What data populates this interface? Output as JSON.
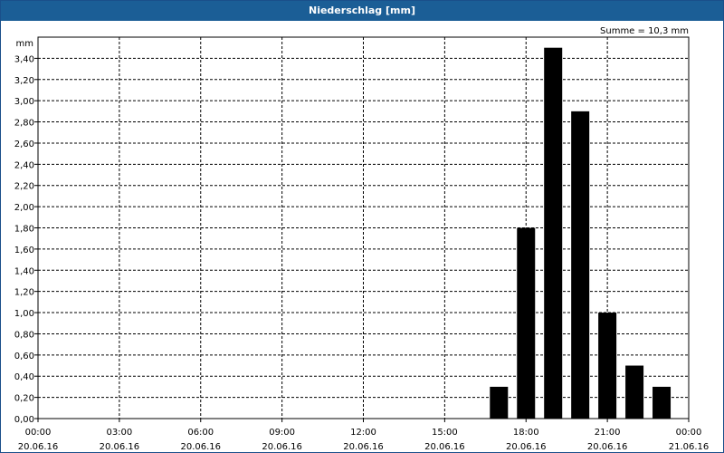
{
  "window": {
    "title": "Niederschlag [mm]"
  },
  "chart_data": {
    "type": "bar",
    "title": "Niederschlag [mm]",
    "ylabel": "mm",
    "xlabel": "",
    "ylim": [
      0,
      3.6
    ],
    "yticks": [
      "0,00",
      "0,20",
      "0,40",
      "0,60",
      "0,80",
      "1,00",
      "1,20",
      "1,40",
      "1,60",
      "1,80",
      "2,00",
      "2,20",
      "2,40",
      "2,60",
      "2,80",
      "3,00",
      "3,20",
      "3,40"
    ],
    "xlim": [
      "20.06.16 00:00",
      "21.06.16 00:00"
    ],
    "xticks": [
      {
        "time": "00:00",
        "date": "20.06.16"
      },
      {
        "time": "03:00",
        "date": "20.06.16"
      },
      {
        "time": "06:00",
        "date": "20.06.16"
      },
      {
        "time": "09:00",
        "date": "20.06.16"
      },
      {
        "time": "12:00",
        "date": "20.06.16"
      },
      {
        "time": "15:00",
        "date": "20.06.16"
      },
      {
        "time": "18:00",
        "date": "20.06.16"
      },
      {
        "time": "21:00",
        "date": "20.06.16"
      },
      {
        "time": "00:00",
        "date": "21.06.16"
      }
    ],
    "annotation": "Summe = 10,3 mm",
    "series": [
      {
        "x": [
          "17:00",
          "18:00",
          "19:00",
          "20:00",
          "21:00",
          "22:00",
          "23:00"
        ],
        "values": [
          0.3,
          1.8,
          3.5,
          2.9,
          1.0,
          0.5,
          0.3
        ]
      }
    ],
    "grid": true,
    "colors": {
      "bar": "#000000",
      "grid": "#000000",
      "titlebar": "#1b5e96"
    }
  }
}
